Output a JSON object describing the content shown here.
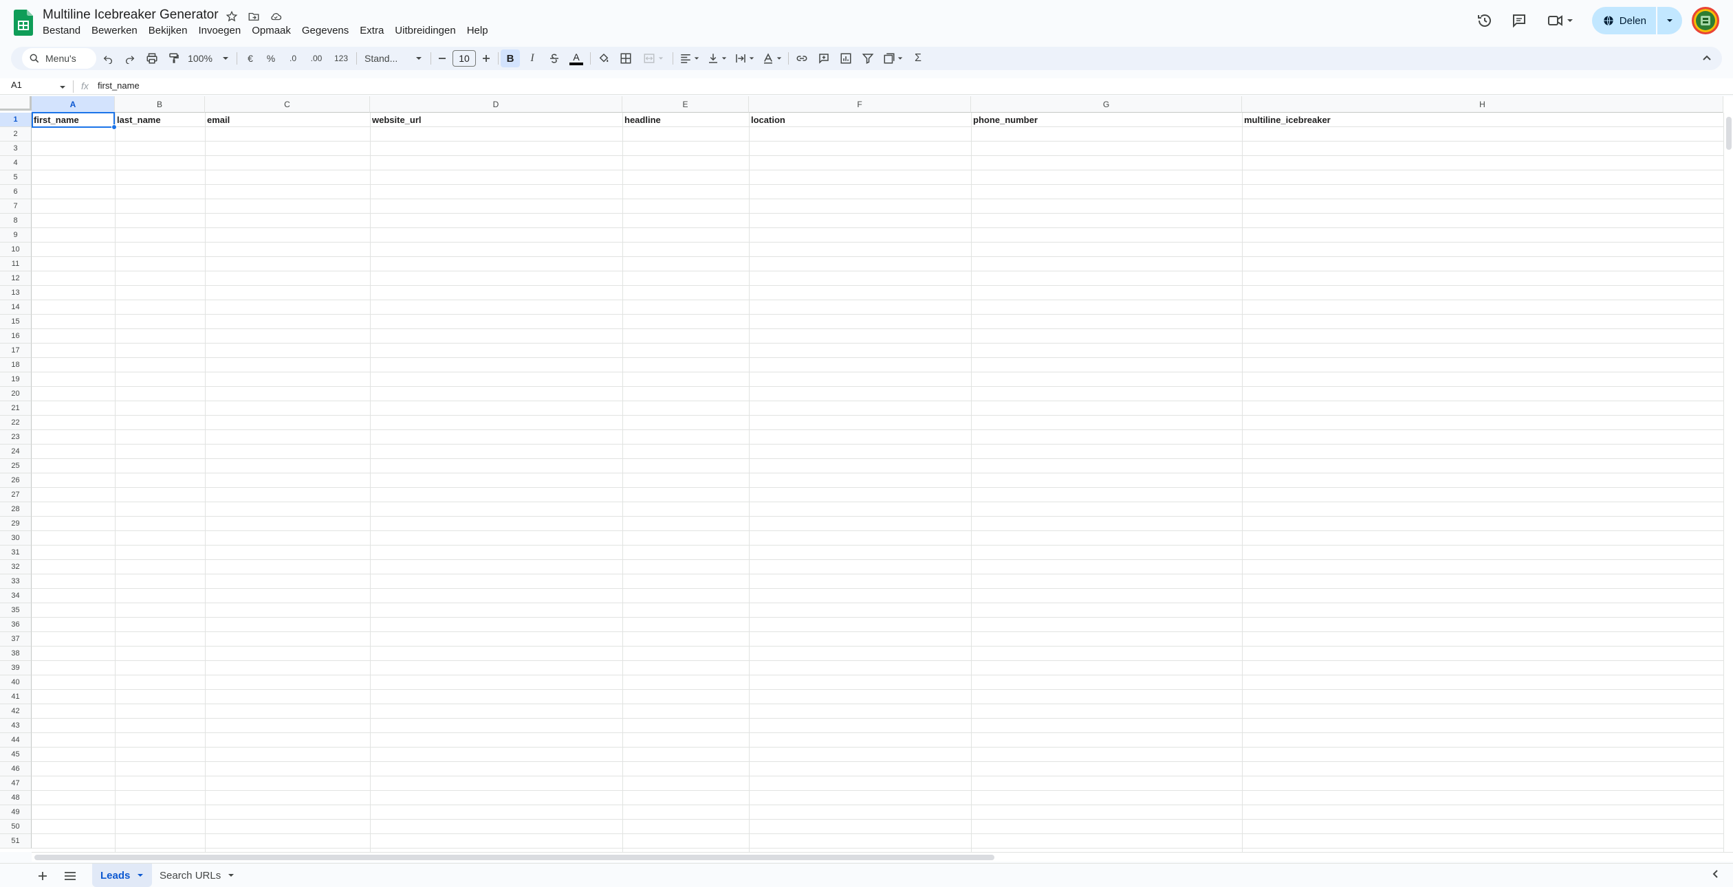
{
  "app": {
    "title": "Multiline Icebreaker Generator",
    "brand_color": "#0f9d58",
    "accent_color": "#0b57d0"
  },
  "menu": [
    "Bestand",
    "Bewerken",
    "Bekijken",
    "Invoegen",
    "Opmaak",
    "Gegevens",
    "Extra",
    "Uitbreidingen",
    "Help"
  ],
  "header_right": {
    "share_label": "Delen"
  },
  "toolbar": {
    "search_label": "Menu's",
    "zoom": "100%",
    "currency": "€",
    "percent": "%",
    "decrease_decimal": ".0",
    "increase_decimal": ".00",
    "number_format": "123",
    "font_name": "Stand...",
    "font_size": "10",
    "bold": "B",
    "italic": "I",
    "text_color_glyph": "A",
    "sum_glyph": "Σ"
  },
  "formula_bar": {
    "cell_ref": "A1",
    "fx": "fx",
    "value": "first_name"
  },
  "grid": {
    "columns": [
      "A",
      "B",
      "C",
      "D",
      "E",
      "F",
      "G",
      "H"
    ],
    "header_row": [
      "first_name",
      "last_name",
      "email",
      "website_url",
      "headline",
      "location",
      "phone_number",
      "multiline_icebreaker"
    ],
    "row_count": 51
  },
  "sheets": [
    {
      "name": "Leads",
      "active": true
    },
    {
      "name": "Search URLs",
      "active": false
    }
  ]
}
